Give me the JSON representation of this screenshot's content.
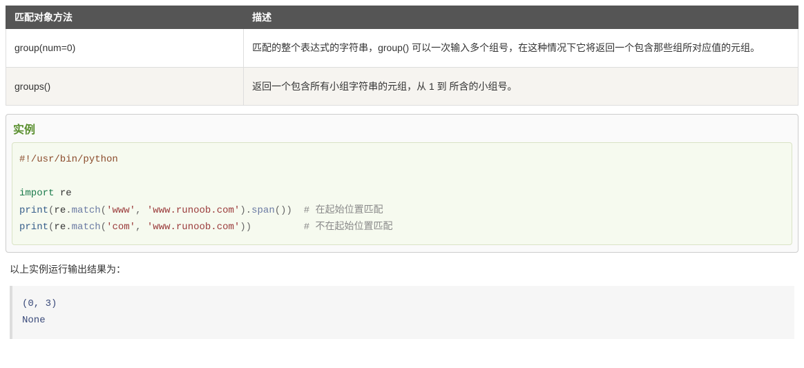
{
  "table": {
    "headers": [
      "匹配对象方法",
      "描述"
    ],
    "rows": [
      {
        "method": "group(num=0)",
        "desc": "匹配的整个表达式的字符串，group() 可以一次输入多个组号，在这种情况下它将返回一个包含那些组所对应值的元组。"
      },
      {
        "method": "groups()",
        "desc": "返回一个包含所有小组字符串的元组，从 1 到 所含的小组号。"
      }
    ]
  },
  "example": {
    "title": "实例",
    "code": {
      "shebang": "#!/usr/bin/python",
      "import_kw": "import",
      "import_mod": "re",
      "print_fn": "print",
      "re_attr": "re",
      "match_fn": "match",
      "span_fn": "span",
      "str_www": "'www'",
      "str_url": "'www.runoob.com'",
      "str_com": "'com'",
      "comment1": "# 在起始位置匹配",
      "comment2": "# 不在起始位置匹配"
    }
  },
  "result_label": "以上实例运行输出结果为：",
  "output": "(0, 3)\nNone"
}
